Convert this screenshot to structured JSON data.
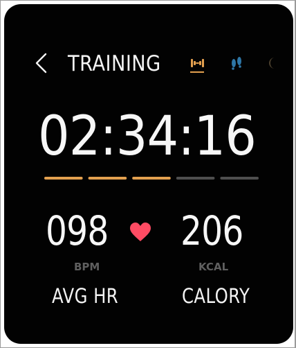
{
  "header": {
    "back_icon": "chevron-left-icon",
    "title": "TRAINING",
    "mode_icons": [
      "dumbbell-icon",
      "footsteps-icon",
      "moon-icon"
    ]
  },
  "workout": {
    "elapsed_time": "02:34:16",
    "progress_completed_segments": 3,
    "progress_total_segments": 5
  },
  "stats": {
    "heart_rate": {
      "value": "098",
      "unit": "BPM",
      "label": "AVG HR",
      "icon": "heart-icon"
    },
    "calories": {
      "value": "206",
      "unit": "KCAL",
      "label": "CALORY"
    }
  },
  "colors": {
    "screen_background": "#020202",
    "text_primary": "#f7f7f7",
    "text_secondary": "#5f5f5f",
    "accent_orange": "#e3a04f",
    "accent_blue": "#2e76a6",
    "heart_red": "#ff4b63",
    "progress_inactive": "#4e4e4e"
  }
}
